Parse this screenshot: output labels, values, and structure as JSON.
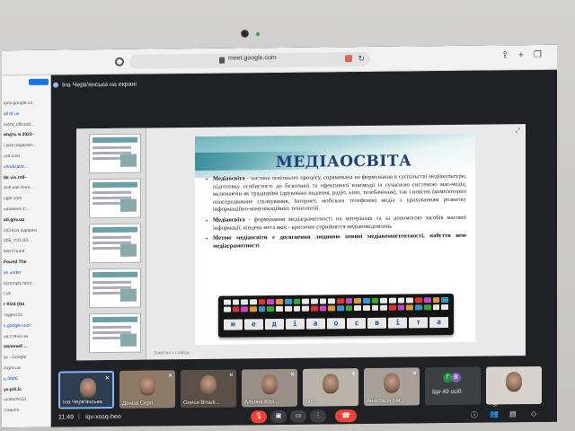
{
  "browser": {
    "url": "meet.google.com"
  },
  "sidepanel": {
    "lines": [
      "ions.google.co",
      "all of us",
      "ment_officeId...",
      "водть в 2021-",
      "і розглядаюмт...",
      "ure.com",
      "v/Indicator...",
      "bk vis.roll-",
      "але кає ючні...",
      "ugle.com",
      "ьваання rc...",
      "ad.gov.ua",
      "ОО.Каз.підпрям",
      "005_Y01.03...",
      "Not Found",
      "Found The",
      "es under",
      "I/cmmpls.html...",
      "t.uk",
      "r KO4 (Ha",
      "тадент21",
      "s.google.com",
      "на стена на",
      "овленнб ...",
      "ук - Google",
      "d.gov.ua",
      "ц ЗМІЄ",
      "ук.plX.Ic",
      "ucator/KCo",
      "тпиш/Ін"
    ]
  },
  "meet": {
    "presenter_label": "Іна Черв'янська на екрані",
    "notes_placeholder": "Заметки к слайду",
    "slide": {
      "title": "МЕДІАОСВІТА",
      "p1_term": "Медіаосвіта",
      "p1_text": " - частина освітнього процесу, спрямована на формування в суспільстві медіакультури, підготовку особистості до безпечної та ефективної взаємодії із сучасною системою мас-медіа, включаючи як традиційні (друковані видання, радіо, кіно, телебачення), так і новітні (комп'ютерно опосередковане спілкування, Інтернет, мобільна телефонія) медіа з урахуванням розвитку інформаційно-комунікаційних технологій.",
      "p2_term": "Медіаосвіта",
      "p2_text": " - формування медіаграмотності на матеріалах та за допомогою засобів масової інформації, кінцева мета якої - критичне сприйняття медіаповідомлень",
      "p3_text": "Метою медіаосвіти є досягнення людиною певної медіакомпетентності, набуття нею медіаграмотності",
      "keyboard_word": [
        "м",
        "е",
        "д",
        "і",
        "а",
        "о",
        "с",
        "в",
        "і",
        "т",
        "а"
      ]
    },
    "participants": [
      {
        "name": "Іна Черв'янська",
        "active": true
      },
      {
        "name": "Деніза Сергі..."
      },
      {
        "name": "Олеся Віталі..."
      },
      {
        "name": "Альона Юрі..."
      },
      {
        "name": "Бог..."
      },
      {
        "name": "Анастасія Ми..."
      }
    ],
    "more": {
      "label": "Ще 49 осіб",
      "avatars": [
        "Г",
        "В"
      ]
    },
    "bottom": {
      "time": "11:49",
      "separator": "|",
      "meeting_code": "iqv-xssq-heo",
      "participants_count": "57"
    }
  }
}
